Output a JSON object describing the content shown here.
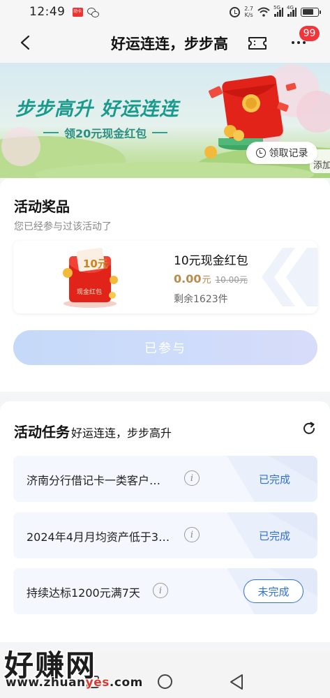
{
  "status_bar": {
    "time": "12:49",
    "app_badge": "动卡",
    "speed_value": "2.7",
    "speed_unit": "K/s",
    "signal_1": "5G",
    "signal_2": "4G",
    "battery_level": 0.75
  },
  "header": {
    "title": "好运连连，步步高",
    "notification_count": "99"
  },
  "banner": {
    "title": "步步高升 好运连连",
    "subtitle": "领20元现金红包",
    "claim_record_label": "领取记录",
    "add_label": "添加"
  },
  "prize_section": {
    "title": "活动奖品",
    "subtitle": "您已经参与过该活动了",
    "prize": {
      "image_value": "10元",
      "image_caption": "现金红包",
      "name": "10元现金红包",
      "price": "0.00",
      "price_unit": "元",
      "original_price": "10.00元",
      "stock": "剩余1623件"
    },
    "joined_button": "已参与"
  },
  "task_section": {
    "title": "活动任务",
    "title_sub": "好运连连，步步高升",
    "tasks": [
      {
        "label": "济南分行借记卡一类客户…",
        "status": "已完成"
      },
      {
        "label": "2024年4月月均资产低于3…",
        "status": "已完成"
      },
      {
        "label": "持续达标1200元满7天",
        "status": "未完成"
      }
    ]
  },
  "watermark": {
    "main": "好赚网",
    "url_prefix": "www.zhuan",
    "url_highlight": "yes",
    "url_suffix": ".com"
  },
  "colors": {
    "accent_blue": "#2f6fd8",
    "badge_red": "#f0353b",
    "price_gold": "#b98b4d",
    "banner_teal": "#1a9a8c"
  }
}
